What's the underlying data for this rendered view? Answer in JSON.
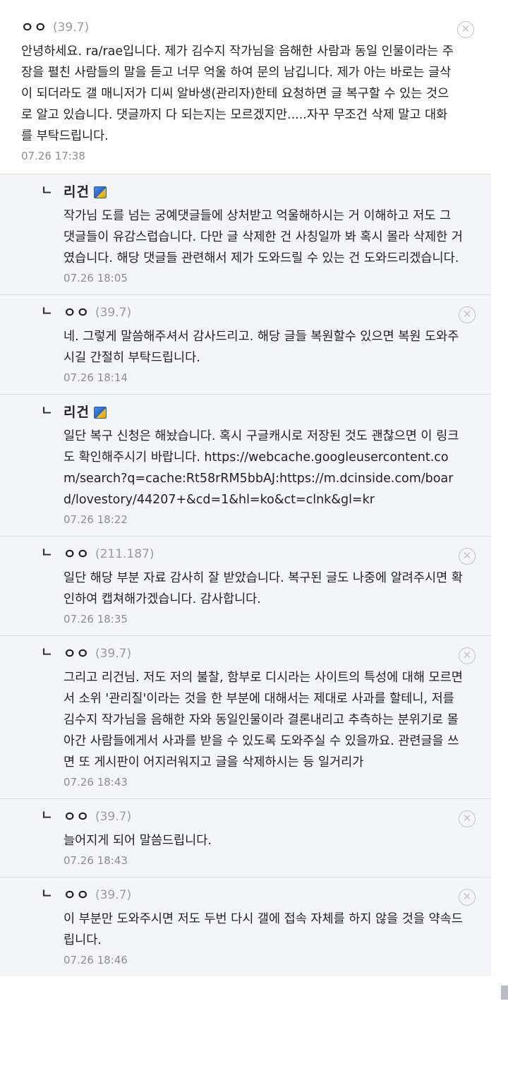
{
  "comments": [
    {
      "nick": "ㅇㅇ",
      "ip": "(39.7)",
      "text": "안녕하세요. ra/rae입니다. 제가 김수지 작가님을 음해한 사람과 동일 인물이라는 주장을 펼친 사람들의 말을 듣고 너무 억울 하여 문의 남깁니다. 제가 아는 바로는 글삭이 되더라도 갤 매니저가 디씨 알바생(관리자)한테 요청하면 글 복구할 수 있는 것으로 알고 있습니다. 댓글까지 다 되는지는 모르겠지만.....자꾸 무조건 삭제 말고 대화를 부탁드립니다.",
      "time": "07.26 17:38"
    }
  ],
  "replies": [
    {
      "nick": "리건",
      "ip": "",
      "manager": true,
      "text": "작가님 도를 넘는 궁예댓글들에 상처받고 억울해하시는 거 이해하고 저도 그 댓글들이 유감스럽습니다. 다만 글 삭제한 건 사칭일까 봐 혹시 몰라 삭제한 거였습니다. 해당 댓글들 관련해서 제가 도와드릴 수 있는 건 도와드리겠습니다.",
      "time": "07.26 18:05"
    },
    {
      "nick": "ㅇㅇ",
      "ip": "(39.7)",
      "manager": false,
      "text": "네. 그렇게 말씀해주셔서 감사드리고. 해당 글들 복원할수 있으면 복원 도와주시길 간절히 부탁드립니다.",
      "time": "07.26 18:14"
    },
    {
      "nick": "리건",
      "ip": "",
      "manager": true,
      "text": "일단 복구 신청은 해놨습니다. 혹시 구글캐시로 저장된 것도 괜찮으면 이 링크도 확인해주시기 바랍니다. https://webcache.googleusercontent.com/search?q=cache:Rt58rRM5bbAJ:https://m.dcinside.com/board/lovestory/44207+&cd=1&hl=ko&ct=clnk&gl=kr",
      "time": "07.26 18:22"
    },
    {
      "nick": "ㅇㅇ",
      "ip": "(211.187)",
      "manager": false,
      "text": "일단 해당 부분 자료 감사히 잘 받았습니다. 복구된 글도 나중에 알려주시면 확인하여 캡쳐해가겠습니다. 감사합니다.",
      "time": "07.26 18:35"
    },
    {
      "nick": "ㅇㅇ",
      "ip": "(39.7)",
      "manager": false,
      "text": "그리고 리건님. 저도 저의 불찰, 함부로 디시라는 사이트의 특성에 대해 모르면서 소위 '관리질'이라는 것을 한 부분에 대해서는 제대로 사과를 할테니, 저를 김수지 작가님을 음해한 자와 동일인물이라 결론내리고 추측하는 분위기로 몰아간 사람들에게서 사과를 받을 수 있도록 도와주실 수 있을까요. 관련글을 쓰면 또 게시판이 어지러워지고 글을 삭제하시는 등 일거리가",
      "time": "07.26 18:43"
    },
    {
      "nick": "ㅇㅇ",
      "ip": "(39.7)",
      "manager": false,
      "text": "늘어지게 되어 말씀드립니다.",
      "time": "07.26 18:43"
    },
    {
      "nick": "ㅇㅇ",
      "ip": "(39.7)",
      "manager": false,
      "text": "이 부분만 도와주시면 저도 두번 다시 갤에 접속 자체를 하지 않을 것을 약속드립니다.",
      "time": "07.26 18:46"
    }
  ],
  "icons": {
    "reply_arrow": "ㄴ",
    "delete": "✕"
  }
}
